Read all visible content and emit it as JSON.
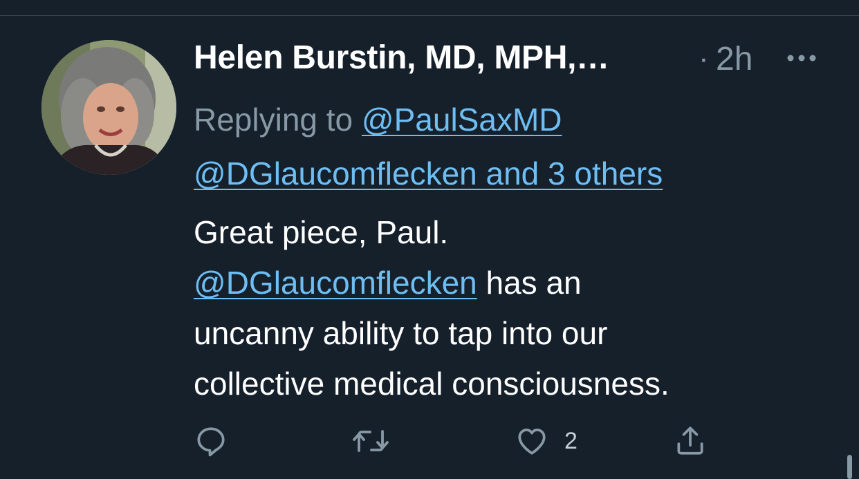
{
  "tweet": {
    "author": {
      "display_name": "Helen Burstin, MD, MPH,…",
      "avatar_icon": "profile-photo"
    },
    "separator": "·",
    "timestamp": "2h",
    "more_icon": "more-horizontal-icon",
    "reply_context": {
      "prefix": "Replying to ",
      "mention_1": "@PaulSaxMD",
      "mention_2": "@DGlaucomflecken and 3 others"
    },
    "text": {
      "line_1": "Great piece, Paul.",
      "mention": "@DGlaucomflecken",
      "line_2_rest": " has an",
      "line_3": "uncanny ability to tap into our",
      "line_4": "collective medical consciousness."
    },
    "actions": {
      "reply_icon": "reply-icon",
      "retweet_icon": "retweet-icon",
      "like_icon": "heart-icon",
      "like_count": "2",
      "share_icon": "share-icon"
    }
  },
  "colors": {
    "background": "#15202b",
    "link": "#6ebef4",
    "muted": "#8899a6",
    "text": "#ffffff"
  }
}
